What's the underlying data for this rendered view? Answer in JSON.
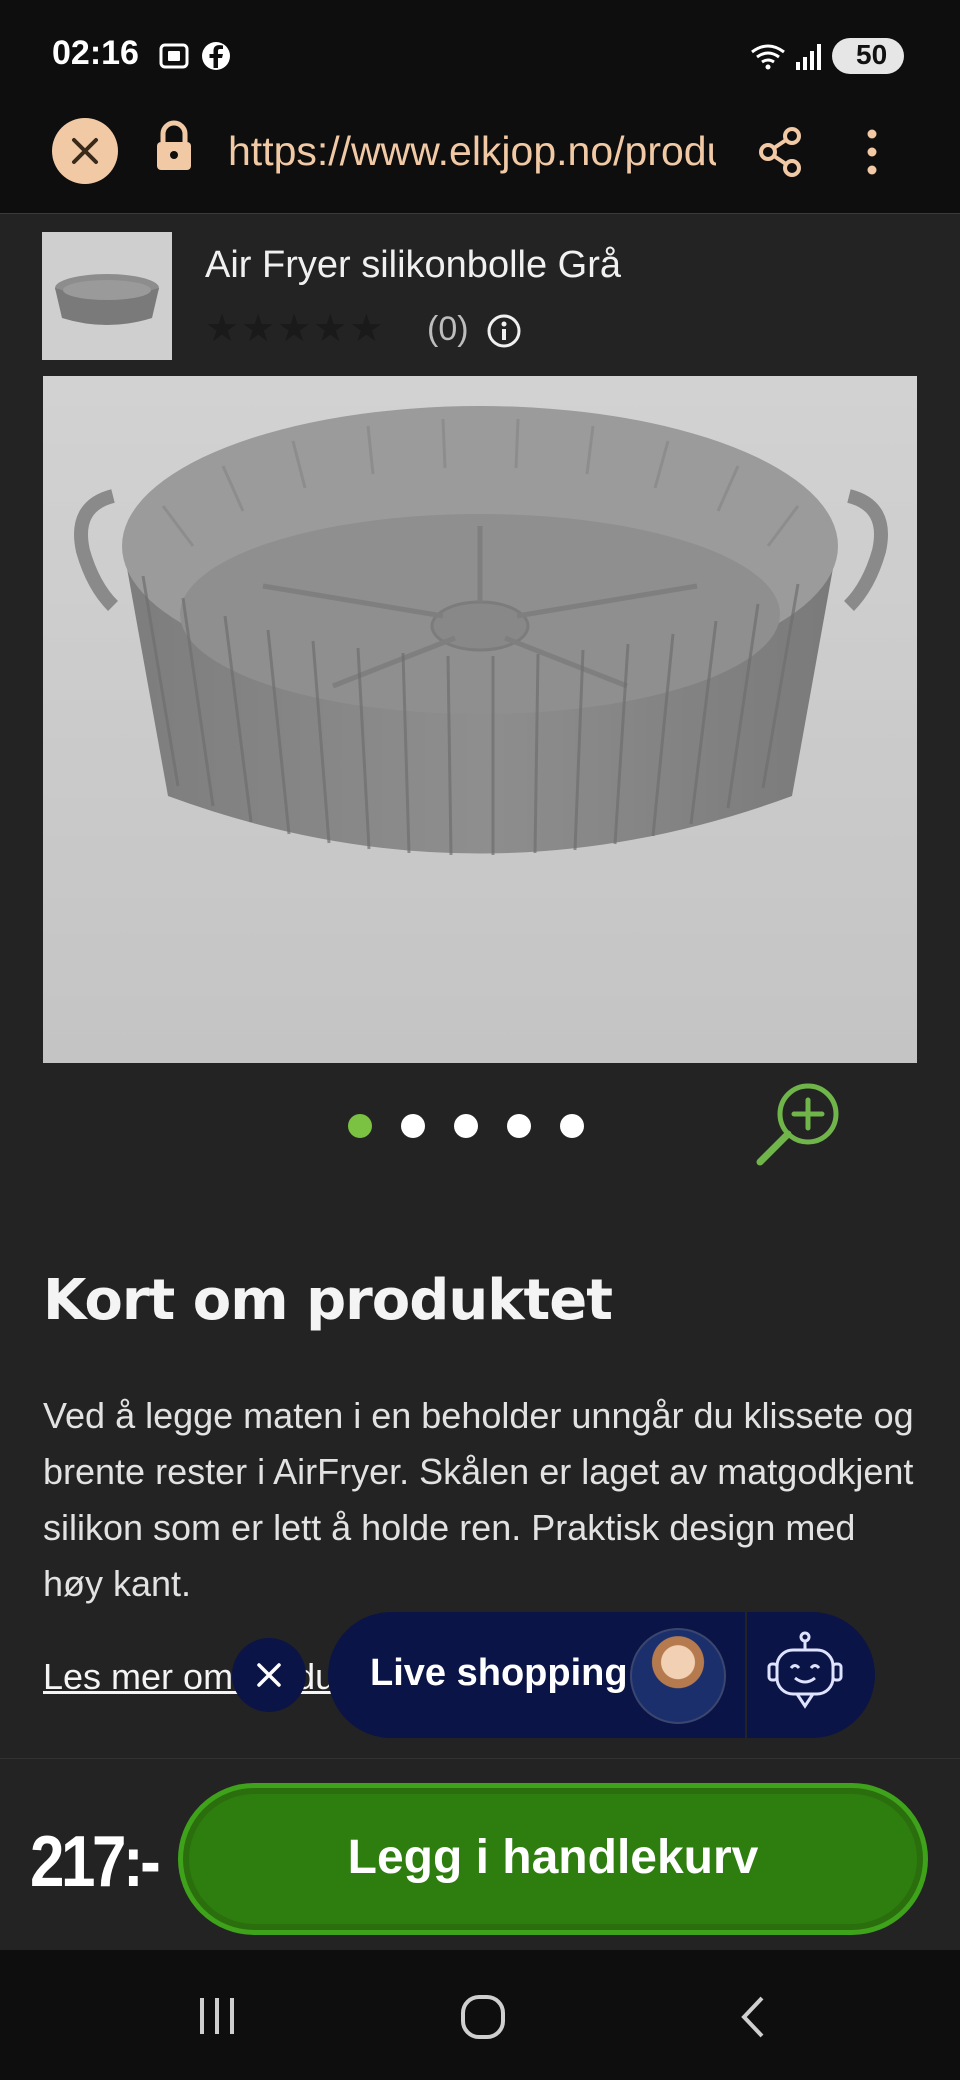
{
  "status_bar": {
    "time": "02:16",
    "battery": "50",
    "icons": [
      "screenshot-icon",
      "facebook-icon",
      "wifi-icon",
      "signal-icon",
      "battery-icon"
    ]
  },
  "browser": {
    "url": "https://www.elkjop.no/product",
    "icons": [
      "close-icon",
      "lock-icon",
      "share-icon",
      "more-vert-icon"
    ]
  },
  "product": {
    "title": "Air Fryer silikonbolle Grå",
    "rating_count": "(0)",
    "stars_filled": 0,
    "stars_total": 5,
    "price": "217:-"
  },
  "carousel": {
    "total": 5,
    "active_index": 0
  },
  "description": {
    "heading": "Kort om produktet",
    "text": "Ved å legge maten i en beholder unngår du klissete og brente rester i AirFryer. Skålen er laget av matgodkjent silikon som er lett å holde ren. Praktisk design med høy kant.",
    "read_more": "Les mer om produktet"
  },
  "live_shopping": {
    "label": "Live shopping"
  },
  "cart": {
    "add_label": "Legg i handlekurv"
  },
  "colors": {
    "background": "#232323",
    "accent_green": "#2e7d0f",
    "url_color": "#f1c9a5",
    "live_navy": "#0b1446"
  }
}
